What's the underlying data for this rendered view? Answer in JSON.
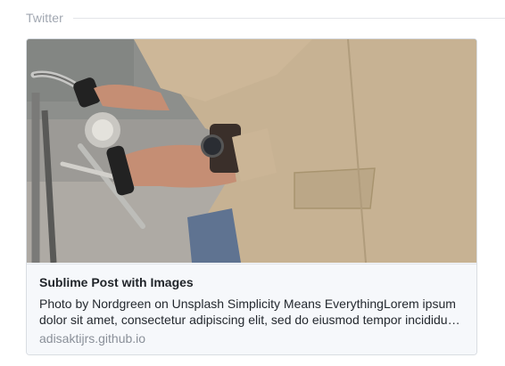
{
  "section": {
    "title": "Twitter"
  },
  "card": {
    "title": "Sublime Post with Images",
    "description": "Photo by Nordgreen on Unsplash Simplicity Means EverythingLorem ipsum dolor sit amet, consectetur adipiscing elit, sed do eiusmod tempor incididunt ut labore et dolore magna aliqua.",
    "domain": "adisaktijrs.github.io",
    "image_icon": "photo-person-bicycle-wristwatch"
  }
}
